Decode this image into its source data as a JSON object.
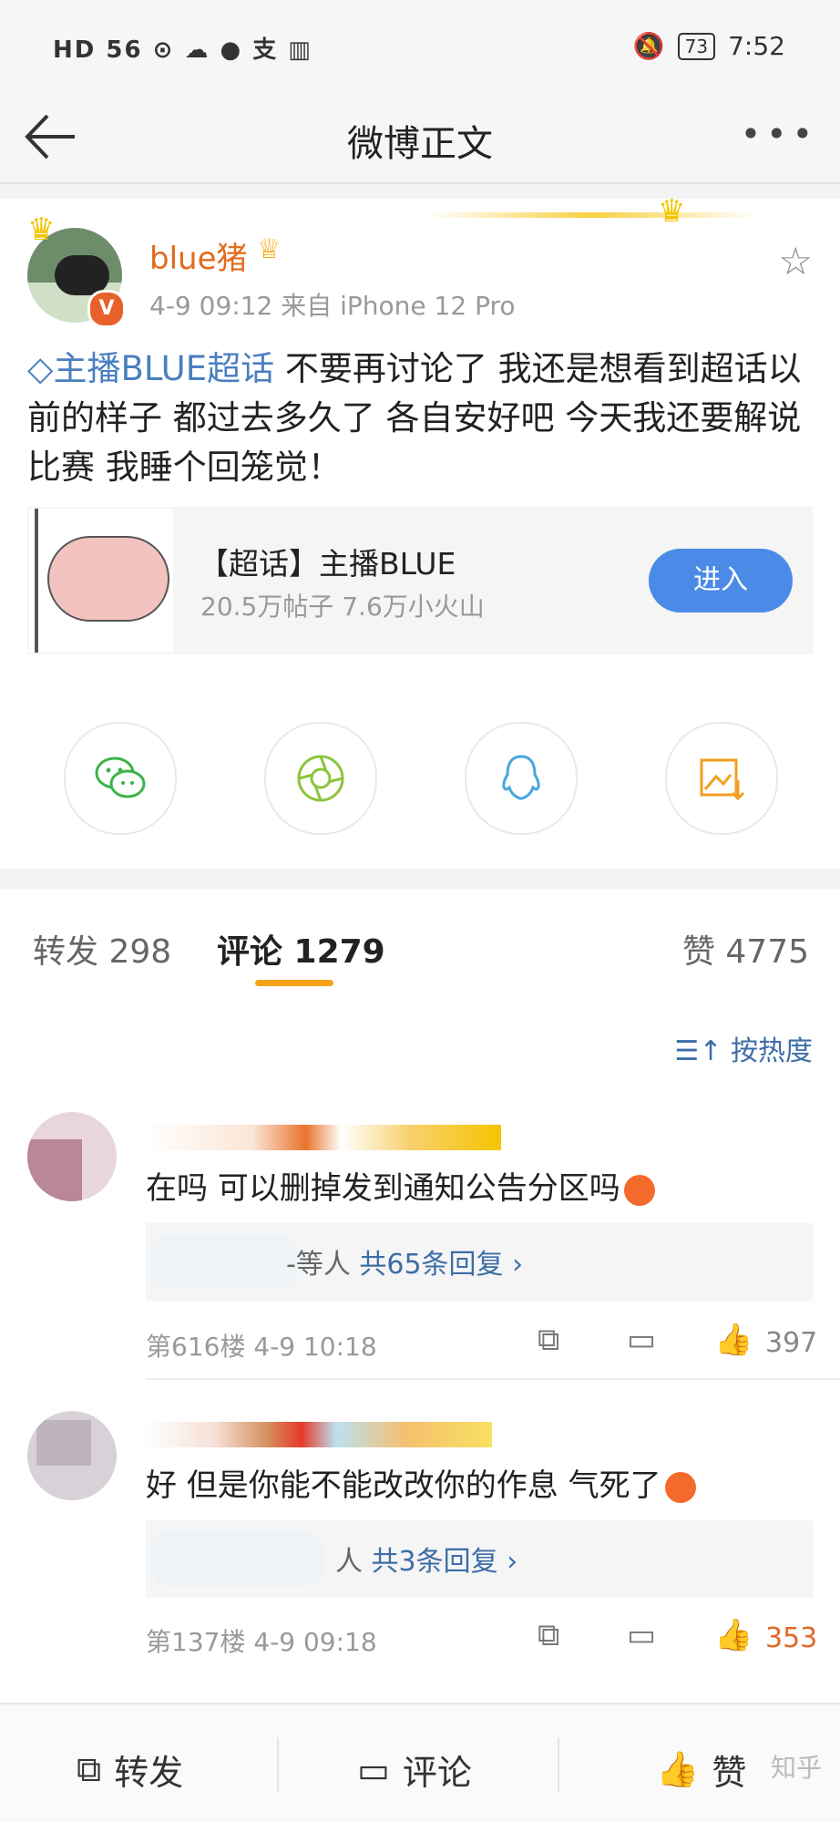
{
  "status": {
    "left_icons": "HD 56 ⊙ ☁ ● 支 ▥",
    "battery": "73",
    "time": "7:52"
  },
  "nav": {
    "title": "微博正文",
    "more": "•••"
  },
  "post": {
    "username": "blue猪",
    "time_source": "4-9 09:12  来自 iPhone 12 Pro",
    "hashtag": "主播BLUE超话",
    "body": " 不要再讨论了 我还是想看到超话以前的样子 都过去多久了 各自安好吧 今天我还要解说比赛 我睡个回笼觉！"
  },
  "topic_card": {
    "name": "【超话】主播BLUE",
    "stats": "20.5万帖子 7.6万小火山",
    "enter_label": "进入"
  },
  "share_icons": [
    "wechat-icon",
    "moments-icon",
    "qq-icon",
    "save-image-icon"
  ],
  "tabs": {
    "repost": "转发 298",
    "comment": "评论 1279",
    "like": "赞 4775"
  },
  "sort": {
    "label": "☰↑ 按热度"
  },
  "comments": [
    {
      "text": "在吗 可以删掉发到通知公告分区吗",
      "reply_prefix": "-等人",
      "reply_count": "共65条回复 ›",
      "floor_time": "第616楼  4-9 10:18",
      "likes": "397",
      "liked": false
    },
    {
      "text": "好  但是你能不能改改你的作息  气死了",
      "reply_prefix": "人",
      "reply_count": "共3条回复 ›",
      "floor_time": "第137楼  4-9 09:18",
      "likes": "353",
      "liked": true
    }
  ],
  "bottom_bar": {
    "repost": "转发",
    "comment": "评论",
    "like": "赞"
  },
  "watermark": "知乎"
}
